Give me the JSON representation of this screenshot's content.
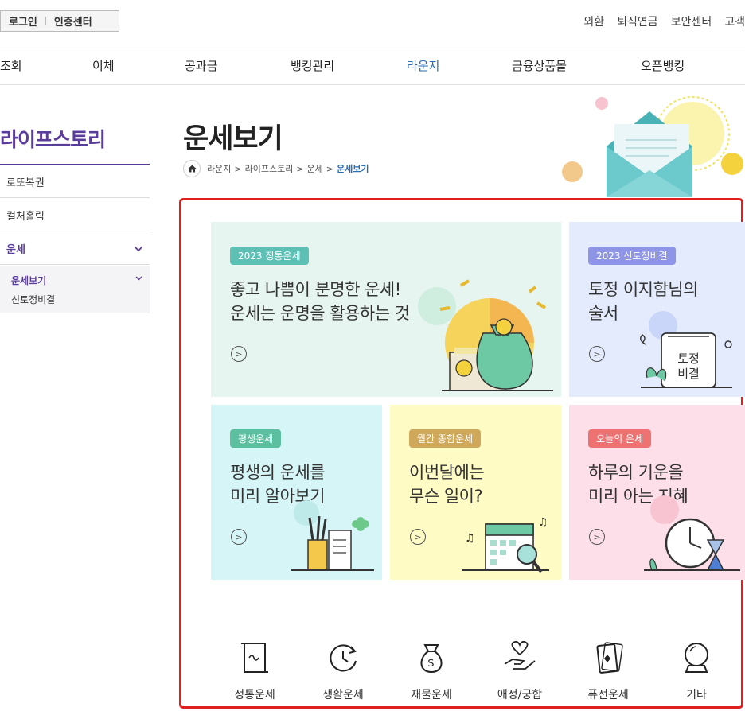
{
  "topbar": {
    "login": "로그인",
    "auth_center": "인증센터",
    "links": [
      "외환",
      "퇴직연금",
      "보안센터",
      "고객"
    ]
  },
  "gnb": [
    "조회",
    "이체",
    "공과금",
    "뱅킹관리",
    "라운지",
    "금융상품몰",
    "오픈뱅킹"
  ],
  "gnb_active": "라운지",
  "sidebar": {
    "title": "라이프스토리",
    "items": [
      {
        "label": "로또복권"
      },
      {
        "label": "컬처홀릭"
      },
      {
        "label": "운세"
      }
    ],
    "sub_items": [
      {
        "label": "운세보기"
      },
      {
        "label": "신토정비결"
      }
    ]
  },
  "page": {
    "title": "운세보기",
    "breadcrumb": [
      "라운지",
      "라이프스토리",
      "운세",
      "운세보기"
    ]
  },
  "cards": [
    {
      "badge": "2023 정통운세",
      "text": "좋고 나쁨이 분명한 운세!\n운세는 운명을 활용하는 것"
    },
    {
      "badge": "2023 신토정비결",
      "text": "토정 이지함님의\n술서",
      "illustration_text": "토정\n비결"
    },
    {
      "badge": "평생운세",
      "text": "평생의 운세를\n미리 알아보기"
    },
    {
      "badge": "월간 종합운세",
      "text": "이번달에는\n무슨 일이?"
    },
    {
      "badge": "오늘의 운세",
      "text": "하루의 기운을\n미리 아는 지혜"
    }
  ],
  "categories": [
    {
      "label": "정통운세",
      "icon": "scroll-icon"
    },
    {
      "label": "생활운세",
      "icon": "cycle-clock-icon"
    },
    {
      "label": "재물운세",
      "icon": "money-bag-icon"
    },
    {
      "label": "애정/궁합",
      "icon": "heart-hand-icon"
    },
    {
      "label": "퓨전운세",
      "icon": "card-icon"
    },
    {
      "label": "기타",
      "icon": "crystal-ball-icon"
    }
  ],
  "colors": {
    "accent": "#5a3d9a",
    "gnb_active": "#2a6bb5",
    "highlight": "#e02020"
  }
}
